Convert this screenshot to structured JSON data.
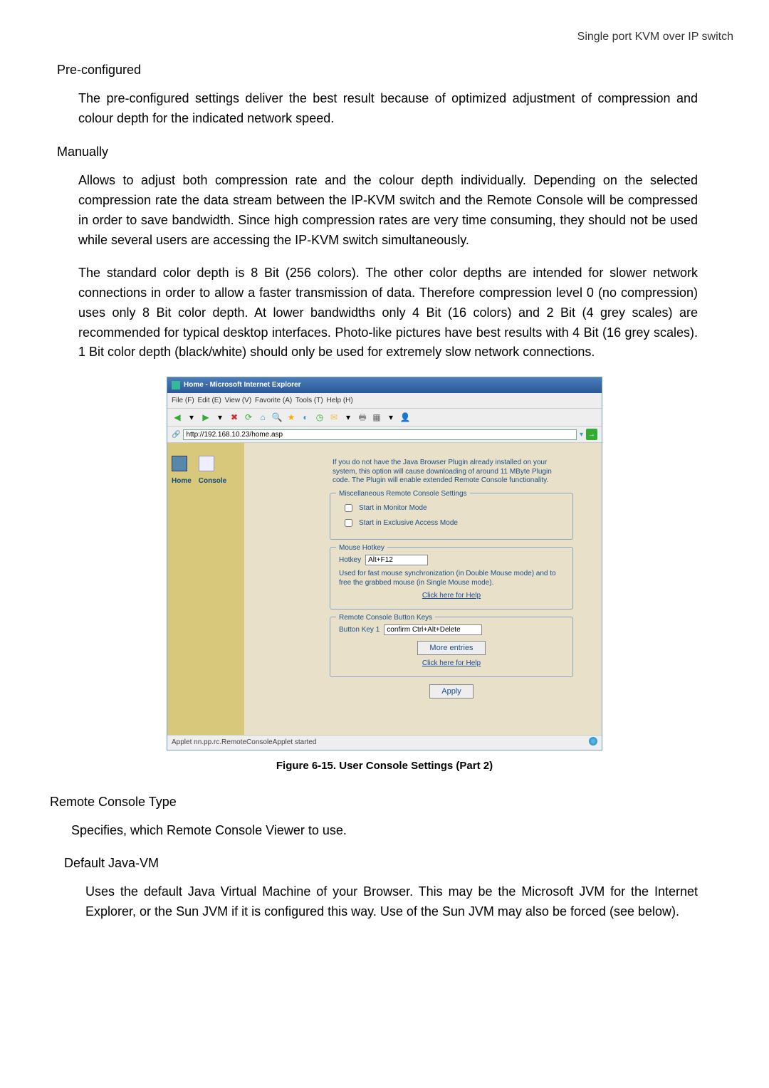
{
  "header": {
    "right": "Single port KVM over IP switch"
  },
  "preconfigured": {
    "heading": "Pre-configured",
    "para": "The pre-configured settings deliver the best result because of optimized adjustment of compression and colour depth for the indicated network speed."
  },
  "manually": {
    "heading": "Manually",
    "para1": "Allows to adjust both compression rate and the colour depth individually. Depending on the selected compression rate the data stream between the IP-KVM switch and the Remote Console will be compressed in order to save bandwidth. Since high compression rates are very time consuming, they should not be used while several users are accessing the IP-KVM switch simultaneously.",
    "para2": "The standard color depth is 8 Bit (256 colors). The other color depths are intended for slower network connections in order to allow a faster transmission of data. Therefore compression level 0 (no compression) uses only 8 Bit color depth. At lower bandwidths only 4 Bit (16 colors) and 2 Bit (4 grey scales) are recommended for typical desktop interfaces. Photo-like pictures have best results with 4 Bit (16 grey scales). 1 Bit color depth (black/white) should only be used for extremely slow network connections."
  },
  "screenshot": {
    "title": "Home - Microsoft Internet Explorer",
    "menu": {
      "file": "File (F)",
      "edit": "Edit (E)",
      "view": "View (V)",
      "favorite": "Favorite (A)",
      "tools": "Tools (T)",
      "help": "Help (H)"
    },
    "address_value": "http://192.168.10.23/home.asp",
    "nav": {
      "home": "Home",
      "console": "Console"
    },
    "plugin_text": "If you do not have the Java Browser Plugin already installed on your system, this option will cause downloading of around 11 MByte Plugin code. The Plugin will enable extended Remote Console functionality.",
    "misc": {
      "legend": "Miscellaneous Remote Console Settings",
      "monitor": "Start in Monitor Mode",
      "exclusive": "Start in Exclusive Access Mode"
    },
    "hotkey": {
      "legend": "Mouse Hotkey",
      "label": "Hotkey",
      "value": "Alt+F12",
      "desc": "Used for fast mouse synchronization (in Double Mouse mode) and to free the grabbed mouse (in Single Mouse mode).",
      "help": "Click here for Help"
    },
    "buttons": {
      "legend": "Remote Console Button Keys",
      "label": "Button Key 1",
      "value": "confirm Ctrl+Alt+Delete",
      "more": "More entries",
      "help": "Click here for Help"
    },
    "apply": "Apply",
    "status_left": "Applet nn.pp.rc.RemoteConsoleApplet started"
  },
  "figure_caption": "Figure 6-15. User Console Settings (Part 2)",
  "remote_console_type": {
    "heading": "Remote Console Type",
    "para": "Specifies, which Remote Console Viewer to use."
  },
  "default_java_vm": {
    "heading": "Default Java-VM",
    "para": "Uses the default Java Virtual Machine of your Browser. This may be the Microsoft JVM for the Internet Explorer, or the Sun JVM if it is configured this way. Use of the Sun JVM may also be forced (see below)."
  }
}
